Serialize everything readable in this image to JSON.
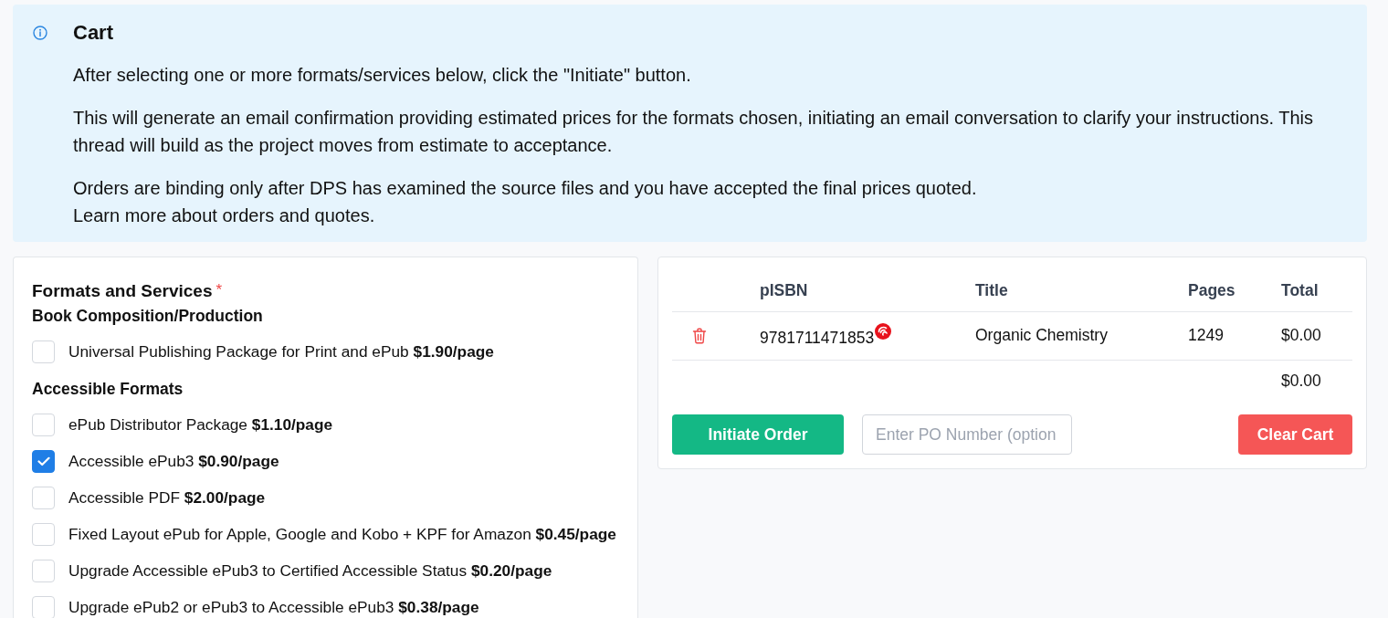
{
  "alert": {
    "title": "Cart",
    "paragraphs": [
      [
        "After selecting one or more formats/services below, click the \"Initiate\" button."
      ],
      [
        "This will generate an email confirmation providing estimated prices for the formats chosen, initiating an email conversation to clarify your instructions. This thread will build as the project moves from estimate to acceptance."
      ],
      [
        "Orders are binding only after DPS has examined the source files and you have accepted the final prices quoted.",
        "Learn more about orders and quotes."
      ]
    ]
  },
  "formats": {
    "title": "Formats and Services",
    "required_mark": "*",
    "groups": [
      {
        "heading": "Book Composition/Production",
        "options": [
          {
            "label": "Universal Publishing Package for Print and ePub **$1.90/page**",
            "checked": false
          }
        ]
      },
      {
        "heading": "Accessible Formats",
        "options": [
          {
            "label": "ePub Distributor Package **$1.10/page**",
            "checked": false
          },
          {
            "label": "Accessible ePub3 **$0.90/page**",
            "checked": true
          },
          {
            "label": "Accessible PDF **$2.00/page**",
            "checked": false
          },
          {
            "label": "Fixed Layout ePub for Apple, Google and Kobo + KPF for Amazon **$0.45/page**",
            "checked": false
          },
          {
            "label": "Upgrade Accessible ePub3 to Certified Accessible Status **$0.20/page**",
            "checked": false
          },
          {
            "label": "Upgrade ePub2 or ePub3 to Accessible ePub3 **$0.38/page**",
            "checked": false
          }
        ]
      }
    ]
  },
  "cart": {
    "columns": [
      "pISBN",
      "Title",
      "Pages",
      "Total"
    ],
    "rows": [
      {
        "isbn": "9781711471853",
        "title": "Organic Chemistry",
        "pages": "1249",
        "total": "$0.00"
      }
    ],
    "grand_total": "$0.00",
    "initiate_button": "Initiate Order",
    "po_field": {
      "placeholder": "Enter PO Number (option"
    },
    "clear_button": "Clear Cart"
  }
}
